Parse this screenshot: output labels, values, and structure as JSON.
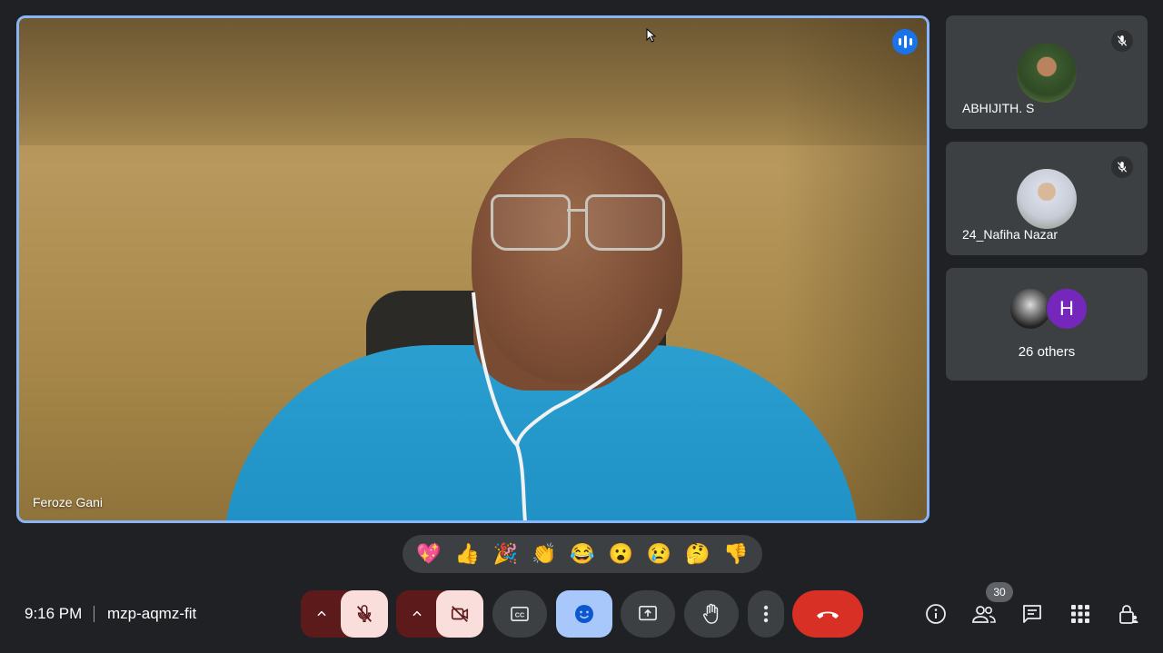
{
  "main_speaker": {
    "name": "Feroze Gani"
  },
  "participants": [
    {
      "name": "ABHIJITH. S",
      "muted": true
    },
    {
      "name": "24_Nafiha Nazar",
      "muted": true
    }
  ],
  "others": {
    "label": "26 others",
    "avatar_initial": "H",
    "avatar_color": "#7627bb"
  },
  "reactions": [
    {
      "name": "sparkling-heart",
      "glyph": "💖"
    },
    {
      "name": "thumbs-up",
      "glyph": "👍"
    },
    {
      "name": "party-popper",
      "glyph": "🎉"
    },
    {
      "name": "clapping-hands",
      "glyph": "👏"
    },
    {
      "name": "tears-of-joy",
      "glyph": "😂"
    },
    {
      "name": "surprised",
      "glyph": "😮"
    },
    {
      "name": "crying",
      "glyph": "😢"
    },
    {
      "name": "thinking",
      "glyph": "🤔"
    },
    {
      "name": "thumbs-down",
      "glyph": "👎"
    }
  ],
  "footer": {
    "time": "9:16 PM",
    "meeting_code": "mzp-aqmz-fit",
    "people_count": "30"
  },
  "colors": {
    "accent": "#8ab4f8",
    "end_call": "#d93025",
    "muted_bg": "#f9dedc",
    "reactions_active": "#a8c7fa"
  }
}
